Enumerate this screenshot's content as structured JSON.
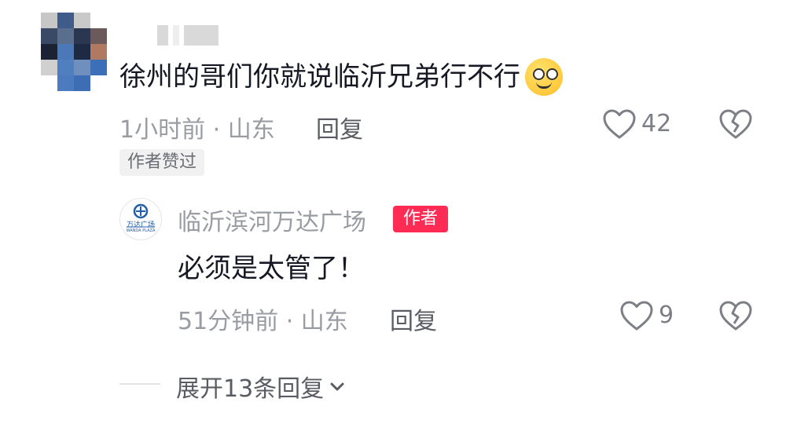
{
  "comment": {
    "text": "徐州的哥们你就说临沂兄弟行不行",
    "emoji": "smirk-emoji",
    "time_location": "1小时前 · 山东",
    "reply_label": "回复",
    "like_count": "42",
    "liked_by_author_badge": "作者赞过"
  },
  "reply": {
    "username": "临沂滨河万达广场",
    "author_badge": "作者",
    "avatar_label": "万达广场",
    "avatar_sub": "WANDA PLAZA",
    "text": "必须是太管了！",
    "time_location": "51分钟前 · 山东",
    "reply_label": "回复",
    "like_count": "9"
  },
  "expand": {
    "label": "展开13条回复"
  },
  "colors": {
    "accent_red": "#fe2c55",
    "meta_gray": "#9a9ca3"
  }
}
